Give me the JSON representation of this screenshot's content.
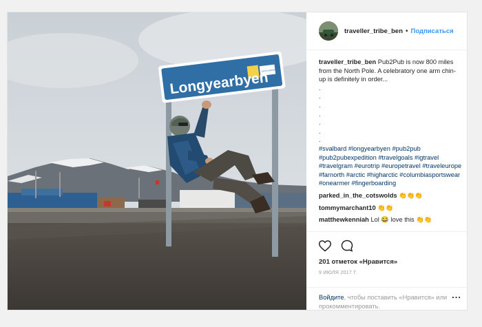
{
  "photo": {
    "sign_text": "Longyearbyen",
    "sign_small_text": "SPITS AVINOR"
  },
  "header": {
    "username": "traveller_tribe_ben",
    "separator": "•",
    "follow_label": "Подписаться"
  },
  "caption": {
    "username": "traveller_tribe_ben",
    "text": "Pub2Pub is now 800 miles from the North Pole. A celebratory one arm chin-up is definitely in order...",
    "dots": [
      ".",
      ".",
      ".",
      ".",
      ".",
      ".",
      "."
    ],
    "hashtags": "#svalbard #longyearbyen #pub2pub #pub2pubexpedition #travelgoals #igtravel #travelgram #eurotrip #europetravel #traveleurope #farnorth #arctic #higharctic #columbiasportswear #onearmer #fingerboarding"
  },
  "comments": [
    {
      "user": "parked_in_the_cotswolds",
      "text": "👏👏👏"
    },
    {
      "user": "tommymarchant10",
      "text": "👏👏"
    },
    {
      "user": "matthewkenniah",
      "text": "Lol 😂 love this 👏👏"
    }
  ],
  "actions": {
    "heart_icon": "heart-icon",
    "comment_icon": "comment-icon",
    "likes_text": "201 отметок «Нравится»",
    "date_text": "9 ИЮЛЯ 2017 Г."
  },
  "login": {
    "link_text": "Войдите",
    "rest_text": ", чтобы поставить «Нравится» или прокомментировать.",
    "more_label": "..."
  },
  "colors": {
    "link": "#003569",
    "follow": "#3897f0",
    "sign": "#2f6fa6"
  }
}
